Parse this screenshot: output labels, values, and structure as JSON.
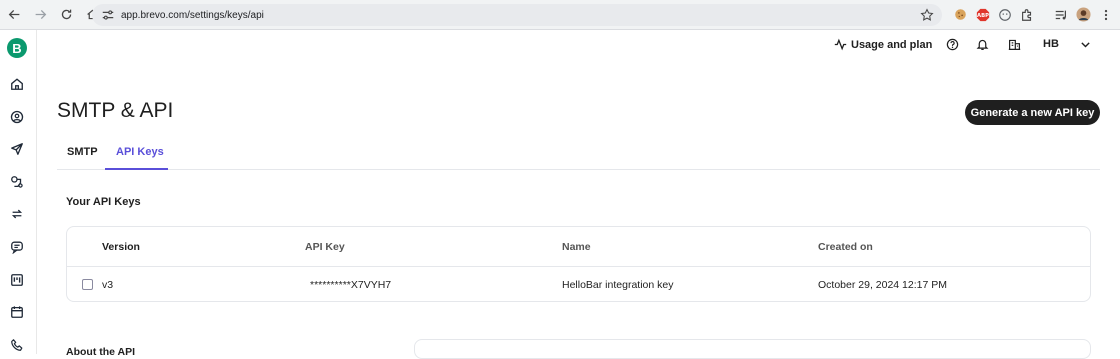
{
  "browser": {
    "url": "app.brevo.com/settings/keys/api"
  },
  "sidebar": {
    "logo_letter": "B"
  },
  "header": {
    "usage_label": "Usage and plan",
    "user_initials": "HB"
  },
  "page": {
    "title": "SMTP & API",
    "generate_button": "Generate a new API key"
  },
  "tabs": [
    {
      "label": "SMTP",
      "active": false
    },
    {
      "label": "API Keys",
      "active": true
    }
  ],
  "api_keys": {
    "section_title": "Your API Keys",
    "columns": [
      "Version",
      "API Key",
      "Name",
      "Created on"
    ],
    "rows": [
      {
        "version": "v3",
        "key": "**********X7VYH7",
        "name": "HelloBar integration key",
        "created": "October 29, 2024 12:17 PM"
      }
    ]
  },
  "about": {
    "title": "About the API"
  },
  "colors": {
    "accent": "#5a4fd9",
    "brand": "#0b996e",
    "primary_button": "#1f1f1f"
  }
}
